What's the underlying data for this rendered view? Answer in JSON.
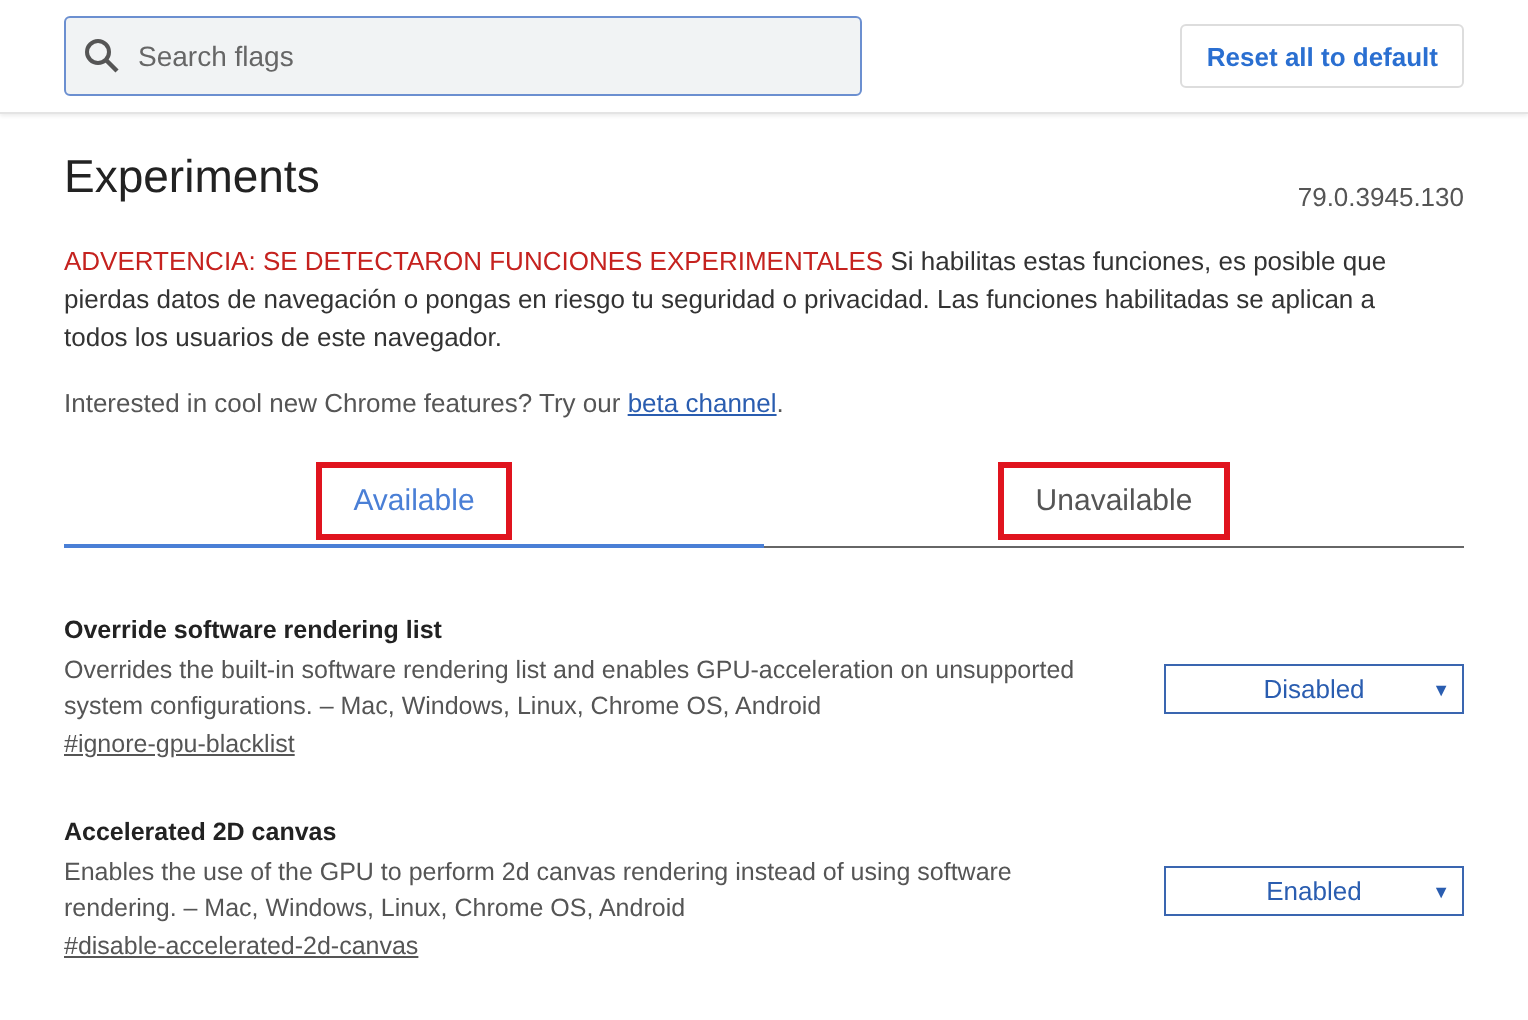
{
  "search": {
    "placeholder": "Search flags"
  },
  "reset_button": "Reset all to default",
  "title": "Experiments",
  "version": "79.0.3945.130",
  "warning": {
    "alert": "ADVERTENCIA: SE DETECTARON FUNCIONES EXPERIMENTALES",
    "text": "Si habilitas estas funciones, es posible que pierdas datos de navegación o pongas en riesgo tu seguridad o privacidad. Las funciones habilitadas se aplican a todos los usuarios de este navegador."
  },
  "promo": {
    "text": "Interested in cool new Chrome features? Try our",
    "link": "beta channel",
    "suffix": "."
  },
  "tabs": [
    {
      "label": "Available",
      "selected": true,
      "highlighted": true
    },
    {
      "label": "Unavailable",
      "selected": false,
      "highlighted": true
    }
  ],
  "flags": [
    {
      "name": "Override software rendering list",
      "description": "Overrides the built-in software rendering list and enables GPU-acceleration on unsupported system configurations. – Mac, Windows, Linux, Chrome OS, Android",
      "link": "#ignore-gpu-blacklist",
      "value": "Disabled",
      "arrow": "▼"
    },
    {
      "name": "Accelerated 2D canvas",
      "description": "Enables the use of the GPU to perform 2d canvas rendering instead of using software rendering. – Mac, Windows, Linux, Chrome OS, Android",
      "link": "#disable-accelerated-2d-canvas",
      "value": "Enabled",
      "arrow": "▼"
    }
  ]
}
